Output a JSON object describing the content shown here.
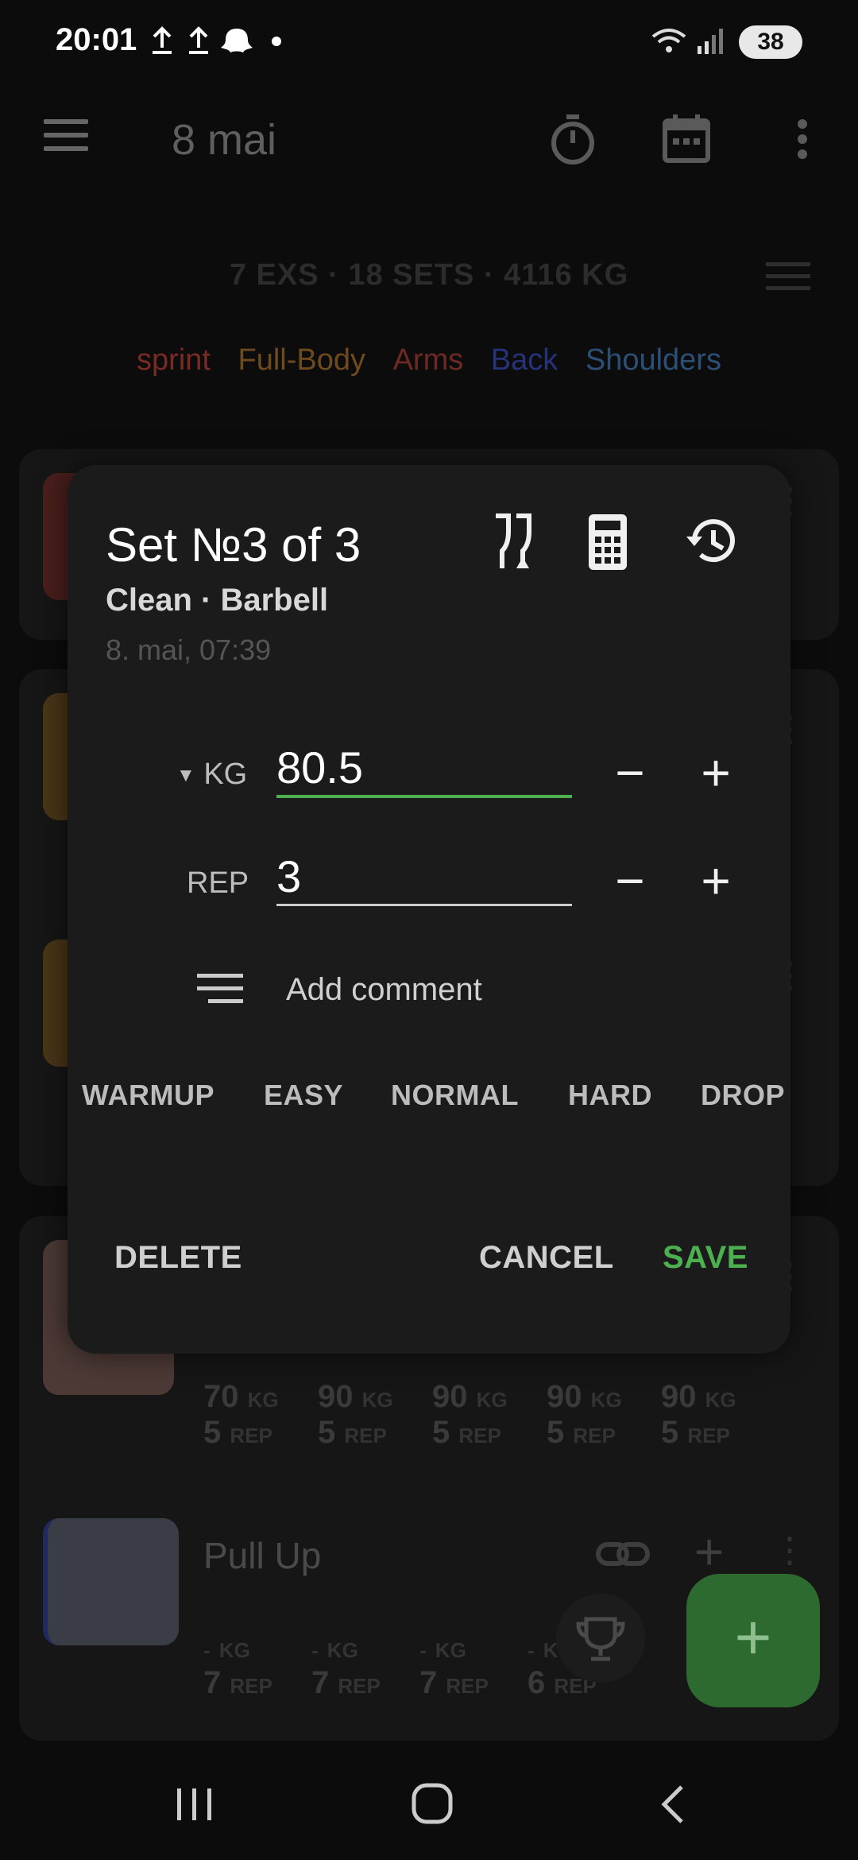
{
  "status_bar": {
    "time": "20:01",
    "battery": "38"
  },
  "app_bar": {
    "title": "8 mai"
  },
  "summary": {
    "text": "7 EXS · 18 SETS · 4116 KG"
  },
  "tags": [
    {
      "label": "sprint",
      "color": "#7a2a24"
    },
    {
      "label": "Full-Body",
      "color": "#6e4a1e"
    },
    {
      "label": "Arms",
      "color": "#6e2a22"
    },
    {
      "label": "Back",
      "color": "#26337a"
    },
    {
      "label": "Shoulders",
      "color": "#2b4f75"
    }
  ],
  "background_cards": {
    "sets_row": [
      {
        "kg": "70",
        "reps": "5"
      },
      {
        "kg": "90",
        "reps": "5"
      },
      {
        "kg": "90",
        "reps": "5"
      },
      {
        "kg": "90",
        "reps": "5"
      },
      {
        "kg": "90",
        "reps": "5"
      }
    ],
    "pull_up": {
      "name": "Pull Up",
      "sets": [
        {
          "kg": "-",
          "reps": "7"
        },
        {
          "kg": "-",
          "reps": "7"
        },
        {
          "kg": "-",
          "reps": "7"
        },
        {
          "kg": "-",
          "reps": "6"
        }
      ]
    },
    "unit_kg": "KG",
    "unit_rep": "REP"
  },
  "dialog": {
    "title": "Set №3 of 3",
    "subtitle": "Clean · Barbell",
    "date": "8. mai, 07:39",
    "weight_label": "KG",
    "weight_value": "80.5",
    "reps_label": "REP",
    "reps_value": "3",
    "minus": "−",
    "plus": "+",
    "comment_placeholder": "Add comment",
    "set_types": [
      "WARMUP",
      "EASY",
      "NORMAL",
      "HARD",
      "DROP"
    ],
    "delete_label": "DELETE",
    "cancel_label": "CANCEL",
    "save_label": "SAVE",
    "accent": "#4caf50"
  },
  "fab": {
    "label": "+"
  }
}
